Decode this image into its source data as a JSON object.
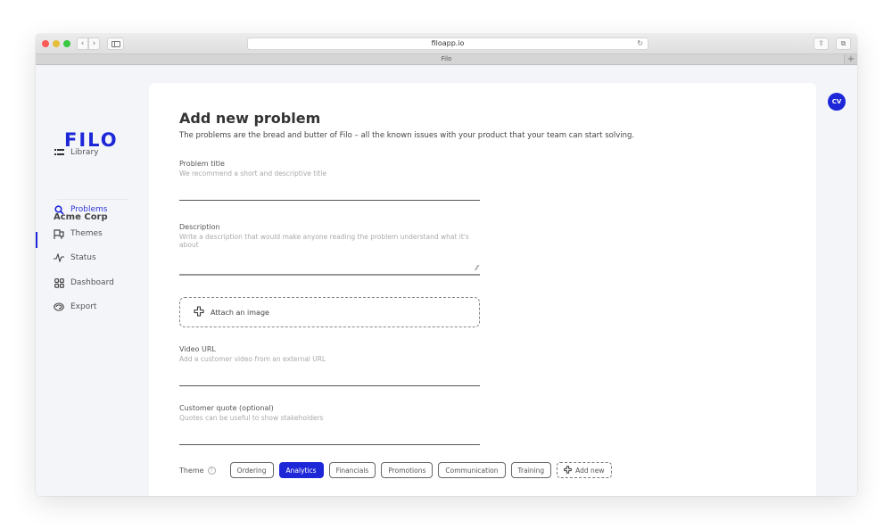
{
  "browser": {
    "url": "filoapp.io",
    "tab_title": "Filo",
    "back_glyph": "‹",
    "forward_glyph": "›",
    "reload_glyph": "↻",
    "share_glyph": "⇪",
    "tabs_glyph": "⧉",
    "new_tab_glyph": "+"
  },
  "brand": {
    "logo": "FILO",
    "accent": "#1d27d8"
  },
  "sidebar": {
    "library": {
      "label": "Library",
      "icon": "list-icon"
    },
    "org_name": "Acme Corp",
    "items": [
      {
        "label": "Problems",
        "icon": "search-icon",
        "active": true
      },
      {
        "label": "Themes",
        "icon": "flag-icon",
        "active": false
      },
      {
        "label": "Status",
        "icon": "pulse-icon",
        "active": false
      },
      {
        "label": "Dashboard",
        "icon": "grid-icon",
        "active": false
      },
      {
        "label": "Export",
        "icon": "export-icon",
        "active": false
      }
    ]
  },
  "user": {
    "initials": "CV"
  },
  "main": {
    "title": "Add new problem",
    "subtitle": "The problems are the bread and butter of Filo – all the known issues with your product that your team can start solving.",
    "fields": {
      "problem_title": {
        "label": "Problem title",
        "placeholder": "We recommend a short and descriptive title",
        "value": ""
      },
      "description": {
        "label": "Description",
        "placeholder": "Write a description that would make anyone reading the problem understand what it's about",
        "value": ""
      },
      "attach": {
        "label": "Attach an image"
      },
      "video_url": {
        "label": "Video URL",
        "placeholder": "Add a customer video from an external URL",
        "value": ""
      },
      "customer_quote": {
        "label": "Customer quote (optional)",
        "placeholder": "Quotes can be useful to show stakeholders",
        "value": ""
      }
    },
    "theme": {
      "label": "Theme",
      "help_glyph": "?",
      "options": [
        "Ordering",
        "Analytics",
        "Financials",
        "Promotions",
        "Communication",
        "Training"
      ],
      "selected": "Analytics",
      "add_label": "Add new"
    }
  }
}
